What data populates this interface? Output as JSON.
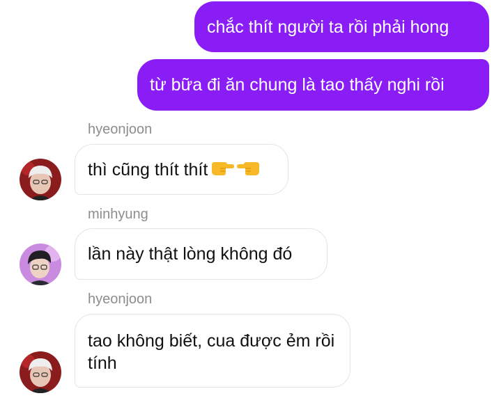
{
  "messages": [
    {
      "direction": "outgoing",
      "text": "chắc thít người ta rồi phải hong"
    },
    {
      "direction": "outgoing",
      "text": "từ bữa đi ăn chung là tao thấy nghi rồi"
    },
    {
      "direction": "incoming",
      "sender": "hyeonjoon",
      "text": "thì cũng thít thít",
      "emoji": [
        "pointing-right-icon",
        "pointing-left-icon"
      ],
      "avatar": "avatar-red-icon"
    },
    {
      "direction": "incoming",
      "sender": "minhyung",
      "text": "lần này thật lòng không đó",
      "avatar": "avatar-purple-icon"
    },
    {
      "direction": "incoming",
      "sender": "hyeonjoon",
      "text": "tao không biết, cua được ẻm rồi tính",
      "avatar": "avatar-red-icon"
    }
  ],
  "colors": {
    "outgoing_bubble": "#8a1cf5",
    "incoming_border": "#e4e4e4",
    "sender_name": "#8d8d8d"
  }
}
